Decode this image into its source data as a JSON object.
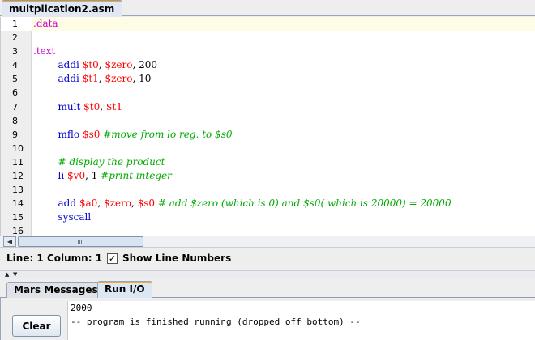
{
  "editor": {
    "file_tab": "multplication2.asm",
    "lines": [
      {
        "n": "1",
        "tokens": [
          {
            "t": ".data",
            "c": "directive"
          }
        ]
      },
      {
        "n": "2",
        "tokens": []
      },
      {
        "n": "3",
        "tokens": [
          {
            "t": ".text",
            "c": "directive"
          }
        ]
      },
      {
        "n": "4",
        "tokens": [
          {
            "t": "        ",
            "c": "punct"
          },
          {
            "t": "addi",
            "c": "instr"
          },
          {
            "t": " ",
            "c": "punct"
          },
          {
            "t": "$t0",
            "c": "reg"
          },
          {
            "t": ", ",
            "c": "punct"
          },
          {
            "t": "$zero",
            "c": "reg"
          },
          {
            "t": ", 200",
            "c": "num"
          }
        ]
      },
      {
        "n": "5",
        "tokens": [
          {
            "t": "        ",
            "c": "punct"
          },
          {
            "t": "addi",
            "c": "instr"
          },
          {
            "t": " ",
            "c": "punct"
          },
          {
            "t": "$t1",
            "c": "reg"
          },
          {
            "t": ", ",
            "c": "punct"
          },
          {
            "t": "$zero",
            "c": "reg"
          },
          {
            "t": ", 10",
            "c": "num"
          }
        ]
      },
      {
        "n": "6",
        "tokens": []
      },
      {
        "n": "7",
        "tokens": [
          {
            "t": "        ",
            "c": "punct"
          },
          {
            "t": "mult",
            "c": "instr"
          },
          {
            "t": " ",
            "c": "punct"
          },
          {
            "t": "$t0",
            "c": "reg"
          },
          {
            "t": ", ",
            "c": "punct"
          },
          {
            "t": "$t1",
            "c": "reg"
          }
        ]
      },
      {
        "n": "8",
        "tokens": []
      },
      {
        "n": "9",
        "tokens": [
          {
            "t": "        ",
            "c": "punct"
          },
          {
            "t": "mflo",
            "c": "instr"
          },
          {
            "t": " ",
            "c": "punct"
          },
          {
            "t": "$s0",
            "c": "reg"
          },
          {
            "t": " ",
            "c": "punct"
          },
          {
            "t": "#move from lo reg. to $s0",
            "c": "comment"
          }
        ]
      },
      {
        "n": "10",
        "tokens": []
      },
      {
        "n": "11",
        "tokens": [
          {
            "t": "        ",
            "c": "punct"
          },
          {
            "t": "# display the product",
            "c": "comment"
          }
        ]
      },
      {
        "n": "12",
        "tokens": [
          {
            "t": "        ",
            "c": "punct"
          },
          {
            "t": "li",
            "c": "instr"
          },
          {
            "t": " ",
            "c": "punct"
          },
          {
            "t": "$v0",
            "c": "reg"
          },
          {
            "t": ", 1 ",
            "c": "num"
          },
          {
            "t": "#print integer",
            "c": "comment"
          }
        ]
      },
      {
        "n": "13",
        "tokens": []
      },
      {
        "n": "14",
        "tokens": [
          {
            "t": "        ",
            "c": "punct"
          },
          {
            "t": "add",
            "c": "instr"
          },
          {
            "t": " ",
            "c": "punct"
          },
          {
            "t": "$a0",
            "c": "reg"
          },
          {
            "t": ", ",
            "c": "punct"
          },
          {
            "t": "$zero",
            "c": "reg"
          },
          {
            "t": ", ",
            "c": "punct"
          },
          {
            "t": "$s0",
            "c": "reg"
          },
          {
            "t": " ",
            "c": "punct"
          },
          {
            "t": "# add $zero (which is 0) and $s0( which is 20000) = 20000",
            "c": "comment"
          }
        ]
      },
      {
        "n": "15",
        "tokens": [
          {
            "t": "        ",
            "c": "punct"
          },
          {
            "t": "syscall",
            "c": "instr"
          }
        ]
      },
      {
        "n": "16",
        "tokens": []
      }
    ]
  },
  "status": {
    "position": "Line: 1 Column: 1",
    "show_line_numbers_label": "Show Line Numbers",
    "show_line_numbers_checked": true
  },
  "messages": {
    "tabs": [
      {
        "label": "Mars Messages",
        "selected": false
      },
      {
        "label": "Run I/O",
        "selected": true
      }
    ],
    "clear_label": "Clear",
    "output": "2000\n-- program is finished running (dropped off bottom) --"
  },
  "icons": {
    "scroll_left": "arrow-left-icon",
    "checkbox_mark": "check-icon"
  },
  "colors": {
    "directive": "#cc00cc",
    "instruction": "#0000cc",
    "register": "#ff0000",
    "comment": "#00aa00",
    "tab_accent": "#f0a73c"
  }
}
